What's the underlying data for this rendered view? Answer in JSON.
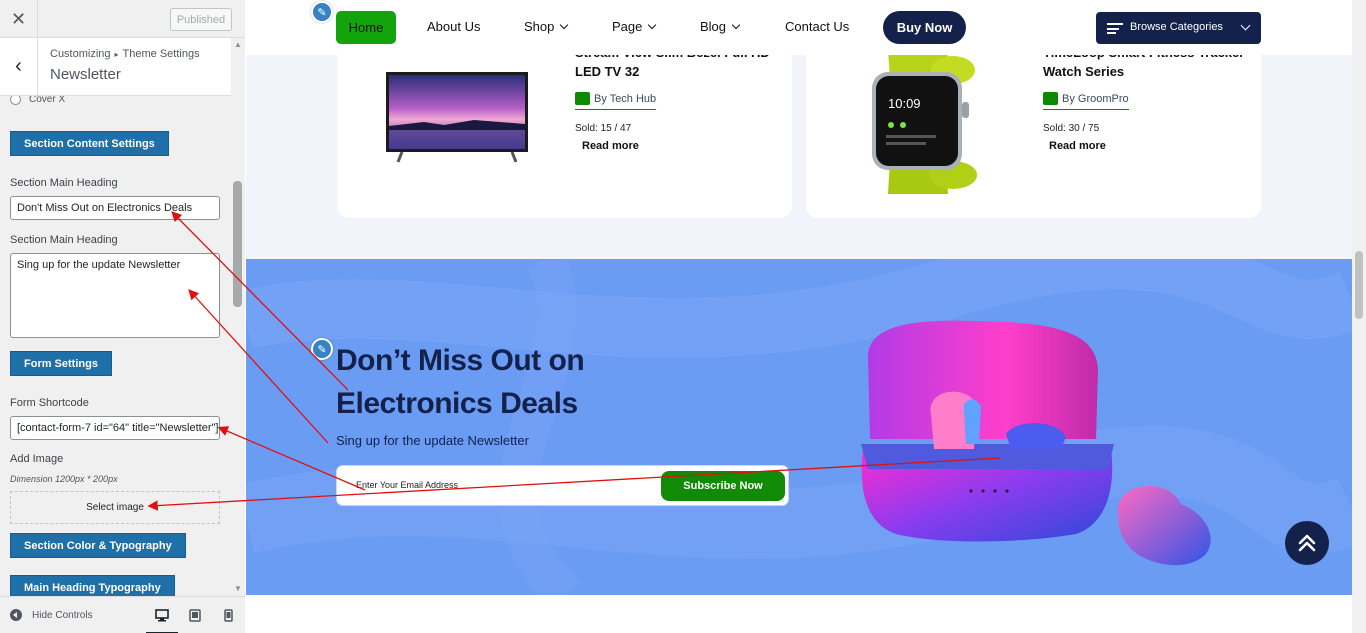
{
  "customizer": {
    "publish_label": "Published",
    "breadcrumb_root": "Customizing",
    "breadcrumb_sep": "▸",
    "breadcrumb_section": "Theme Settings",
    "section_title": "Newsletter",
    "radio_option": "Cover X",
    "section_content_btn": "Section Content Settings",
    "main_heading_label": "Section Main Heading",
    "main_heading_value": "Don't Miss Out on Electronics Deals",
    "sub_heading_label": "Section Main Heading",
    "sub_heading_value": "Sing up for the update Newsletter",
    "form_settings_btn": "Form Settings",
    "form_shortcode_label": "Form Shortcode",
    "form_shortcode_value": "[contact-form-7 id=\"64\" title=\"Newsletter\"]",
    "add_image_label": "Add Image",
    "dimension_hint": "Dimension 1200px * 200px",
    "select_image_label": "Select image",
    "color_typography_btn": "Section Color & Typography",
    "main_heading_typography_btn": "Main Heading Typography",
    "hide_controls_label": "Hide Controls"
  },
  "nav": {
    "home": "Home",
    "about": "About Us",
    "shop": "Shop",
    "page": "Page",
    "blog": "Blog",
    "contact": "Contact Us",
    "buy_now": "Buy Now",
    "browse": "Browse Categories"
  },
  "products": [
    {
      "title": "Stream View Slim Bezel Full HD LED TV 32",
      "vendor": "By Tech Hub",
      "sold": "Sold: 15 / 47",
      "read_more": "Read more"
    },
    {
      "title": "TimeLoop Smart Fitness Tracker Watch Series",
      "vendor": "By GroomPro",
      "sold": "Sold: 30 / 75",
      "read_more": "Read more"
    }
  ],
  "watch_screen": {
    "time": "10:09"
  },
  "newsletter": {
    "heading": "Don’t Miss Out on Electronics Deals",
    "subheading": "Sing up for the update Newsletter",
    "email_placeholder": "Enter Your Email Address",
    "subscribe": "Subscribe Now"
  },
  "colors": {
    "accent_green": "#118a05",
    "navy": "#13214b",
    "newsletter_bg": "#6b9cf4",
    "wp_blue": "#1f6fa8",
    "arrow_red": "#e01010"
  }
}
